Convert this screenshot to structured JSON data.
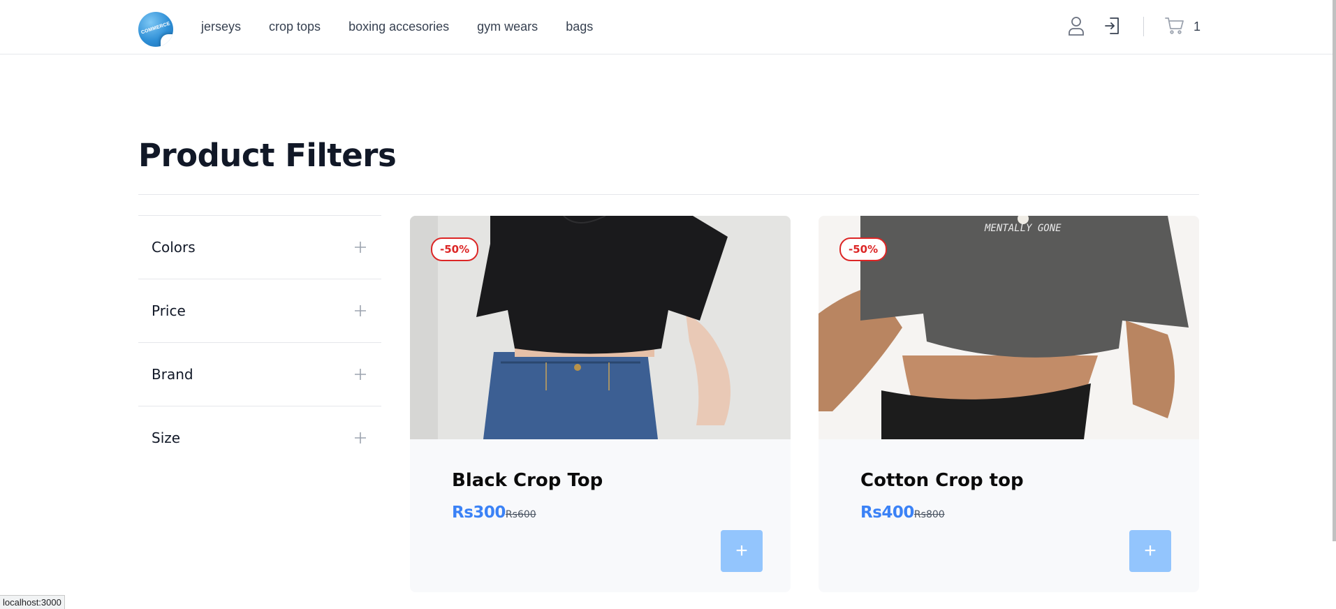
{
  "header": {
    "logo_text": "COMMERCE",
    "nav": [
      "jerseys",
      "crop tops",
      "boxing accesories",
      "gym wears",
      "bags"
    ],
    "cart_count": "1"
  },
  "page": {
    "title": "Product Filters"
  },
  "filters": [
    {
      "label": "Colors",
      "icon": "plus-icon"
    },
    {
      "label": "Price",
      "icon": "plus-icon"
    },
    {
      "label": "Brand",
      "icon": "plus-icon"
    },
    {
      "label": "Size",
      "icon": "plus-icon"
    }
  ],
  "products": [
    {
      "name": "Black Crop Top",
      "price": "Rs300",
      "old_price": "Rs600",
      "discount": "-50%",
      "add_label": "+"
    },
    {
      "name": "Cotton Crop top",
      "price": "Rs400",
      "old_price": "Rs800",
      "discount": "-50%",
      "add_label": "+",
      "print_text": "MENTALLY GONE"
    }
  ],
  "status_bar": "localhost:3000",
  "colors": {
    "accent": "#3b82f6",
    "badge": "#dc2626",
    "add_button": "#93c5fd"
  }
}
